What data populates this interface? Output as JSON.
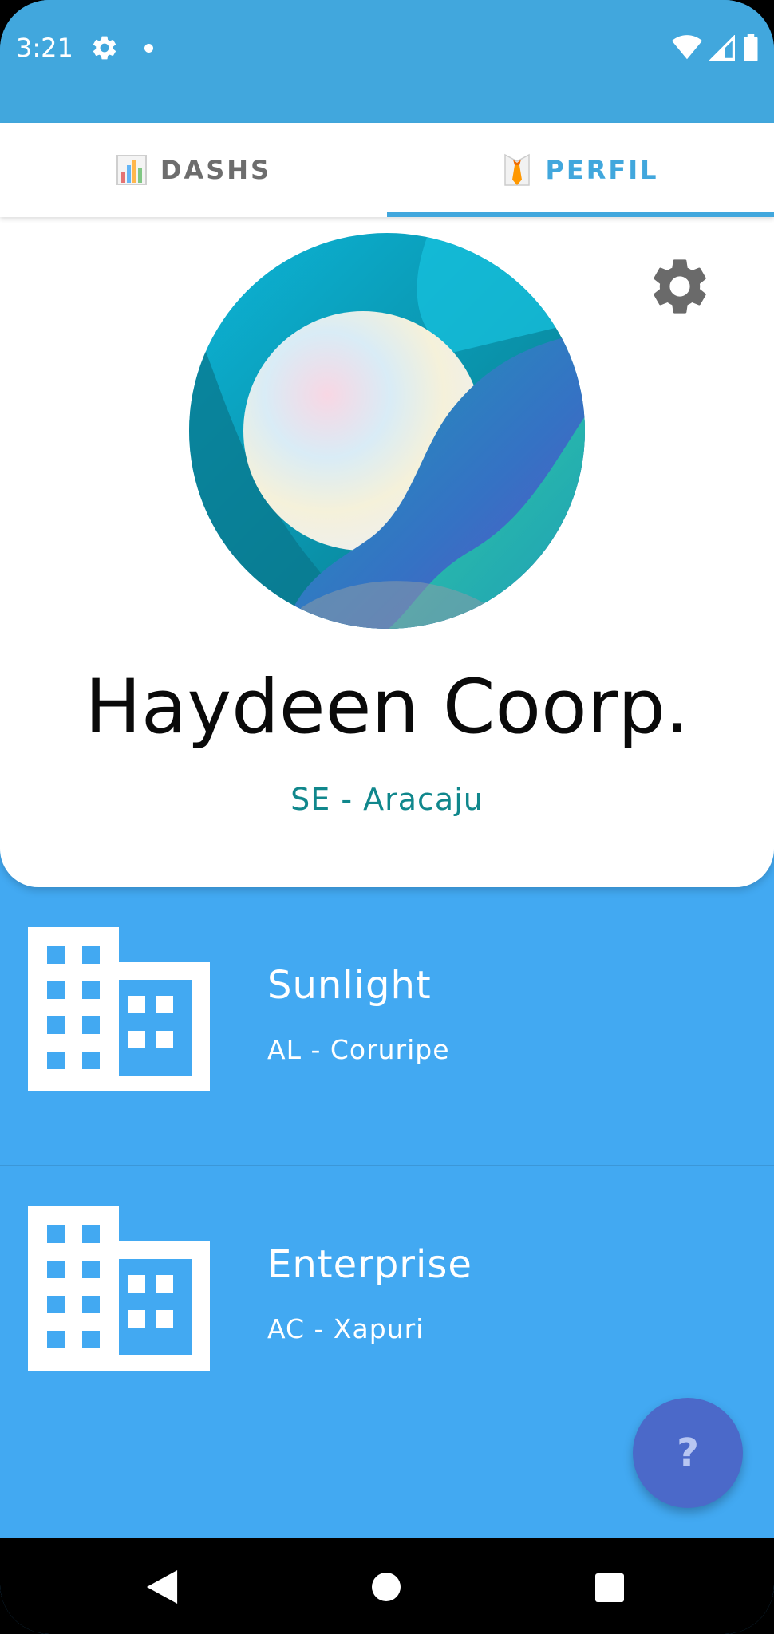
{
  "status_bar": {
    "time": "3:21",
    "icons": [
      "gear-icon",
      "notification-dot",
      "wifi-icon",
      "signal-icon",
      "battery-icon"
    ]
  },
  "tabs": [
    {
      "label": "DASHS",
      "icon": "bar-chart-icon",
      "active": false
    },
    {
      "label": "PERFIL",
      "icon": "necktie-icon",
      "active": true
    }
  ],
  "profile": {
    "name": "Haydeen Coorp.",
    "location": "SE - Aracaju",
    "settings_icon": "gear-icon",
    "avatar_action_icon": "add-photo-icon"
  },
  "companies": [
    {
      "name": "Sunlight",
      "location": "AL - Coruripe",
      "icon": "building-icon"
    },
    {
      "name": "Enterprise",
      "location": "AC - Xapuri",
      "icon": "building-icon"
    }
  ],
  "fab": {
    "label": "?"
  },
  "colors": {
    "status_bar": "#41a7dd",
    "list_background": "#42a9f2",
    "accent": "#41a7dd",
    "location_text": "#10878c",
    "fab": "#4b69c9"
  }
}
